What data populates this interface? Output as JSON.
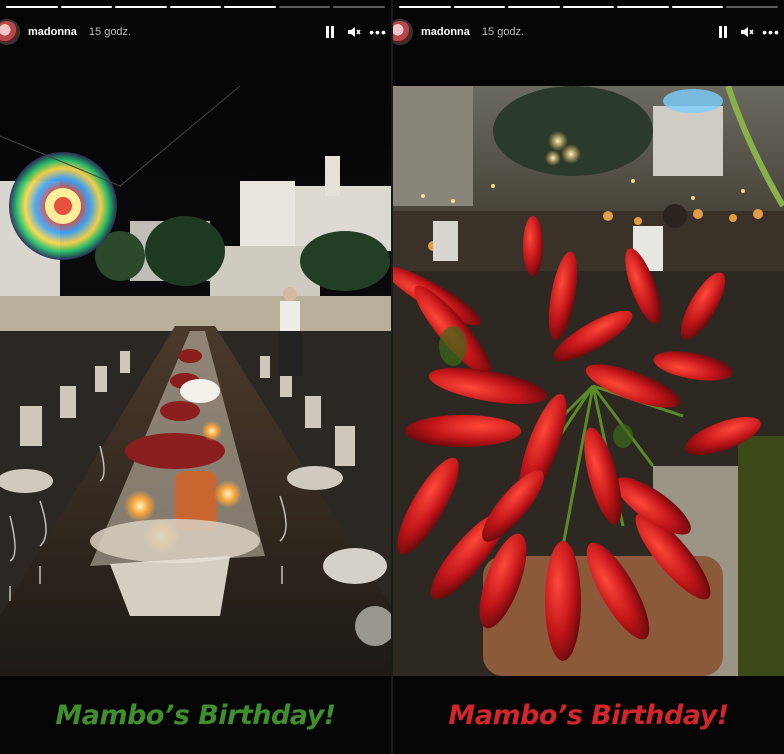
{
  "stories": [
    {
      "username": "madonna",
      "time": "15 godz.",
      "caption": "Mambo’s Birthday!",
      "caption_color": "#3f8f2c",
      "progress_segments": 7,
      "progress_done": 5
    },
    {
      "username": "madonna",
      "time": "15 godz.",
      "caption": "Mambo’s Birthday!",
      "caption_color": "#d3262b",
      "progress_segments": 7,
      "progress_done": 6
    }
  ],
  "icons": {
    "pause": "pause-icon",
    "mute": "mute-icon",
    "more": "more-icon",
    "avatar": "avatar"
  }
}
